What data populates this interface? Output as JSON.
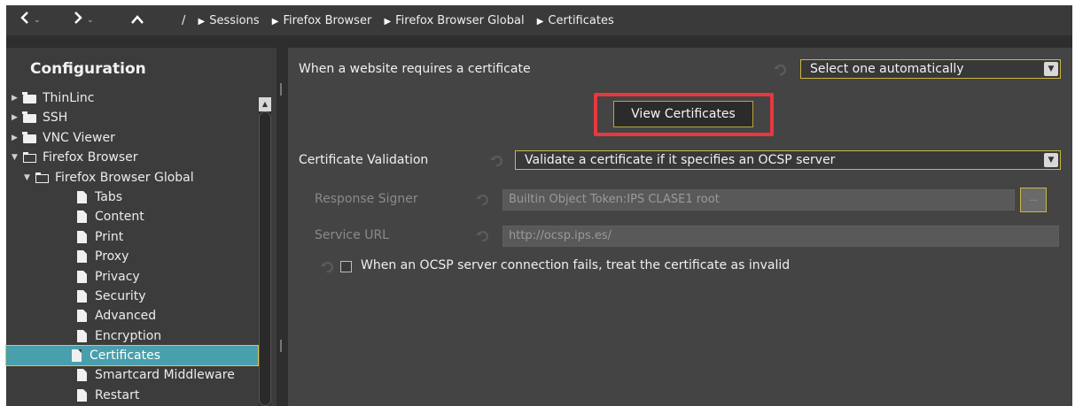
{
  "nav": {
    "back_icon": "chevron-left-icon",
    "forward_icon": "chevron-right-icon",
    "up_icon": "chevron-up-icon",
    "root_separator": "/",
    "breadcrumbs": [
      "Sessions",
      "Firefox Browser",
      "Firefox Browser Global",
      "Certificates"
    ]
  },
  "sidebar": {
    "title": "Configuration",
    "tree": [
      {
        "label": "ThinLinc",
        "level": 0,
        "type": "folder",
        "expanded": false
      },
      {
        "label": "SSH",
        "level": 0,
        "type": "folder",
        "expanded": false
      },
      {
        "label": "VNC Viewer",
        "level": 0,
        "type": "folder",
        "expanded": false
      },
      {
        "label": "Firefox Browser",
        "level": 0,
        "type": "folder",
        "expanded": true
      },
      {
        "label": "Firefox Browser Global",
        "level": 1,
        "type": "folder",
        "expanded": true
      },
      {
        "label": "Tabs",
        "level": 2,
        "type": "file"
      },
      {
        "label": "Content",
        "level": 2,
        "type": "file"
      },
      {
        "label": "Print",
        "level": 2,
        "type": "file"
      },
      {
        "label": "Proxy",
        "level": 2,
        "type": "file"
      },
      {
        "label": "Privacy",
        "level": 2,
        "type": "file"
      },
      {
        "label": "Security",
        "level": 2,
        "type": "file"
      },
      {
        "label": "Advanced",
        "level": 2,
        "type": "file"
      },
      {
        "label": "Encryption",
        "level": 2,
        "type": "file"
      },
      {
        "label": "Certificates",
        "level": 2,
        "type": "file",
        "selected": true
      },
      {
        "label": "Smartcard Middleware",
        "level": 2,
        "type": "file"
      },
      {
        "label": "Restart",
        "level": 2,
        "type": "file"
      }
    ]
  },
  "content": {
    "cert_request": {
      "label": "When a website requires a certificate",
      "value": "Select one automatically"
    },
    "view_certificates_button": "View Certificates",
    "cert_validation": {
      "label": "Certificate Validation",
      "value": "Validate a certificate if it specifies an OCSP server"
    },
    "response_signer": {
      "label": "Response Signer",
      "value": "Builtin Object Token:IPS CLASE1 root",
      "browse_label": "..."
    },
    "service_url": {
      "label": "Service URL",
      "value": "http://ocsp.ips.es/"
    },
    "ocsp_fail": {
      "label": "When an OCSP server connection fails, treat the certificate as invalid",
      "checked": false
    }
  },
  "colors": {
    "selection": "#4a9fad",
    "focus_border": "#c9b840",
    "highlight": "#e8383d"
  }
}
